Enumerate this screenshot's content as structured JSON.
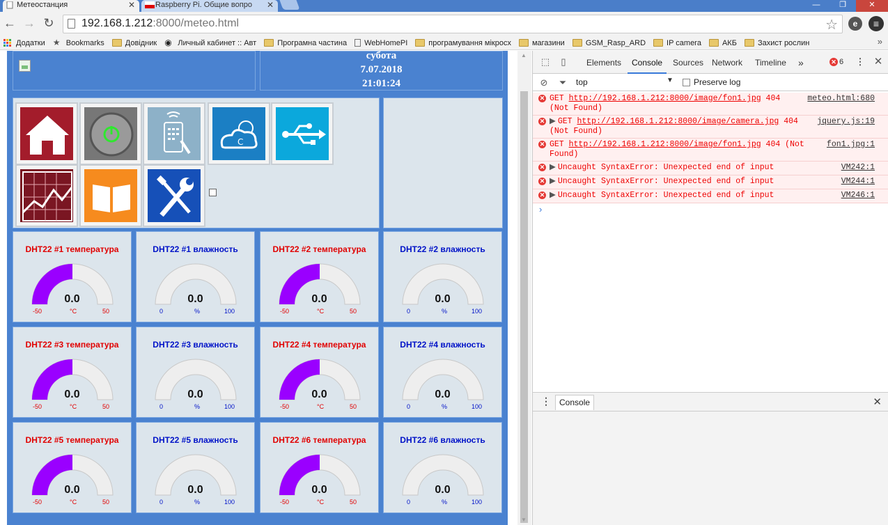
{
  "browser": {
    "tabs": [
      {
        "title": "Метеостанция",
        "active": true
      },
      {
        "title": "Raspberry Pi. Общие вопро",
        "active": false
      }
    ],
    "tab_close_glyph": "✕",
    "url_host": "192.168.1.212",
    "url_rest": ":8000/meteo.html",
    "bookmarks": [
      {
        "label": "Додатки",
        "icon": "apps-grid-icon"
      },
      {
        "label": "Bookmarks",
        "icon": "star-icon"
      },
      {
        "label": "Довідник",
        "icon": "folder-icon"
      },
      {
        "label": "Личный кабинет :: Авт",
        "icon": "waveform-icon"
      },
      {
        "label": "Програмна частина",
        "icon": "folder-icon"
      },
      {
        "label": "WebHomePI",
        "icon": "page-icon"
      },
      {
        "label": "програмування мікросх",
        "icon": "folder-icon"
      },
      {
        "label": "магазини",
        "icon": "folder-icon"
      },
      {
        "label": "GSM_Rasp_ARD",
        "icon": "folder-icon"
      },
      {
        "label": "IP camera",
        "icon": "folder-icon"
      },
      {
        "label": "АКБ",
        "icon": "folder-icon"
      },
      {
        "label": "Захист рослин",
        "icon": "folder-icon"
      }
    ]
  },
  "page": {
    "header": {
      "weekday": "субота",
      "date": "7.07.2018",
      "time": "21:01:24"
    },
    "app_icons": [
      {
        "name": "home-icon",
        "bg": "#a31c2b"
      },
      {
        "name": "power-icon",
        "bg": "#777777"
      },
      {
        "name": "remote-control-icon",
        "bg": "#8db1c8"
      },
      {
        "name": "weather-cloud-icon",
        "bg": "#1b7fc4"
      },
      {
        "name": "usb-icon",
        "bg": "#0ba8dc"
      },
      {
        "name": "chart-icon",
        "bg": "#7a1622"
      },
      {
        "name": "book-icon",
        "bg": "#f68b1e"
      },
      {
        "name": "tools-icon",
        "bg": "#1650b8"
      }
    ],
    "gauges": [
      {
        "title": "DHT22 #1 температура",
        "kind": "temp",
        "value": "0.0",
        "unit": "°C",
        "min": "-50",
        "max": "50",
        "fill": 0.5
      },
      {
        "title": "DHT22 #1 влажность",
        "kind": "hum",
        "value": "0.0",
        "unit": "%",
        "min": "0",
        "max": "100",
        "fill": 0
      },
      {
        "title": "DHT22 #2 температура",
        "kind": "temp",
        "value": "0.0",
        "unit": "°C",
        "min": "-50",
        "max": "50",
        "fill": 0.5
      },
      {
        "title": "DHT22 #2 влажность",
        "kind": "hum",
        "value": "0.0",
        "unit": "%",
        "min": "0",
        "max": "100",
        "fill": 0
      },
      {
        "title": "DHT22 #3 температура",
        "kind": "temp",
        "value": "0.0",
        "unit": "°C",
        "min": "-50",
        "max": "50",
        "fill": 0.5
      },
      {
        "title": "DHT22 #3 влажность",
        "kind": "hum",
        "value": "0.0",
        "unit": "%",
        "min": "0",
        "max": "100",
        "fill": 0
      },
      {
        "title": "DHT22 #4 температура",
        "kind": "temp",
        "value": "0.0",
        "unit": "°C",
        "min": "-50",
        "max": "50",
        "fill": 0.5
      },
      {
        "title": "DHT22 #4 влажность",
        "kind": "hum",
        "value": "0.0",
        "unit": "%",
        "min": "0",
        "max": "100",
        "fill": 0
      },
      {
        "title": "DHT22 #5 температура",
        "kind": "temp",
        "value": "0.0",
        "unit": "°C",
        "min": "-50",
        "max": "50",
        "fill": 0.5
      },
      {
        "title": "DHT22 #5 влажность",
        "kind": "hum",
        "value": "0.0",
        "unit": "%",
        "min": "0",
        "max": "100",
        "fill": 0
      },
      {
        "title": "DHT22 #6 температура",
        "kind": "temp",
        "value": "0.0",
        "unit": "°C",
        "min": "-50",
        "max": "50",
        "fill": 0.5
      },
      {
        "title": "DHT22 #6 влажность",
        "kind": "hum",
        "value": "0.0",
        "unit": "%",
        "min": "0",
        "max": "100",
        "fill": 0
      }
    ],
    "colors": {
      "gauge_fill": "#9a00ff",
      "gauge_track": "#eeeeee",
      "temp_text": "#e10000",
      "hum_text": "#0012c8"
    }
  },
  "devtools": {
    "tabs": [
      "Elements",
      "Console",
      "Sources",
      "Network",
      "Timeline"
    ],
    "active_tab": "Console",
    "more_glyph": "»",
    "error_count": "6",
    "context": "top",
    "preserve_log": "Preserve log",
    "messages": [
      {
        "prefix": "GET ",
        "url": "http://192.168.1.212:8000/image/fon1.jpg",
        "suffix": " 404",
        "line2": "(Not Found)",
        "src": "meteo.html:680",
        "expander": false
      },
      {
        "prefix": "GET ",
        "url": "http://192.168.1.212:8000/image/camera.jpg",
        "suffix": " 404",
        "line2": "(Not Found)",
        "src": "jquery.js:19",
        "expander": true
      },
      {
        "prefix": "GET ",
        "url": "http://192.168.1.212:8000/image/fon1.jpg",
        "suffix": " 404 (Not",
        "line2": "Found)",
        "src": "fon1.jpg:1",
        "expander": false
      },
      {
        "prefix": "Uncaught SyntaxError: Unexpected end of input",
        "url": "",
        "suffix": "",
        "line2": "",
        "src": "VM242:1",
        "expander": true
      },
      {
        "prefix": "Uncaught SyntaxError: Unexpected end of input",
        "url": "",
        "suffix": "",
        "line2": "",
        "src": "VM244:1",
        "expander": true
      },
      {
        "prefix": "Uncaught SyntaxError: Unexpected end of input",
        "url": "",
        "suffix": "",
        "line2": "",
        "src": "VM246:1",
        "expander": true
      }
    ],
    "prompt_glyph": "›",
    "drawer_tab": "Console"
  }
}
